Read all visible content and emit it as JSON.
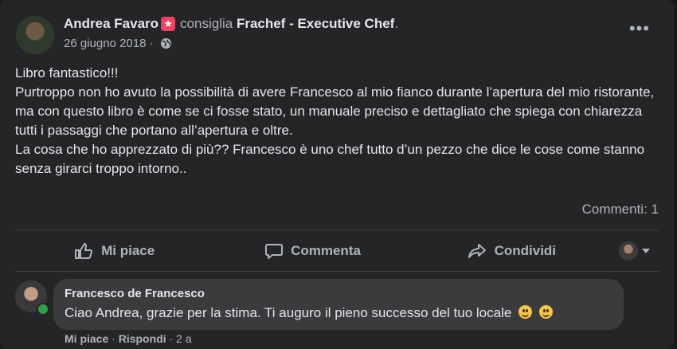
{
  "post": {
    "author": "Andrea Favaro",
    "recommends": "consiglia",
    "page": "Frachef - Executive Chef",
    "period": ".",
    "date": "26 giugno 2018",
    "separator": "·",
    "privacy_icon": "globe-icon",
    "more_icon": "more-options-icon",
    "more_text": "•••",
    "body": [
      "Libro fantastico!!!",
      "Purtroppo non ho avuto la possibilità di avere Francesco al mio fianco durante l’apertura del mio ristorante, ma con questo libro è come se ci fosse stato, un manuale preciso e dettagliato che spiega con chiarezza tutti i passaggi che portano all’apertura e oltre.",
      "La cosa che ho apprezzato di più?? Francesco è uno chef tutto d’un pezzo che dice le cose come stanno senza girarci troppo intorno.."
    ],
    "comments_count": "Commenti: 1"
  },
  "actions": {
    "like": "Mi piace",
    "comment": "Commenta",
    "share": "Condividi"
  },
  "comment": {
    "author": "Francesco de Francesco",
    "text": "Ciao Andrea, grazie per la stima. Ti auguro il pieno successo del tuo locale",
    "like": "Mi piace",
    "reply": "Rispondi",
    "dot": "·",
    "time": "2 a"
  },
  "colors": {
    "background": "#242526",
    "text": "#e4e6eb",
    "secondary": "#b0b3b8",
    "bubble": "#3a3b3c",
    "badge": "#f3425f",
    "online": "#31a24c"
  }
}
